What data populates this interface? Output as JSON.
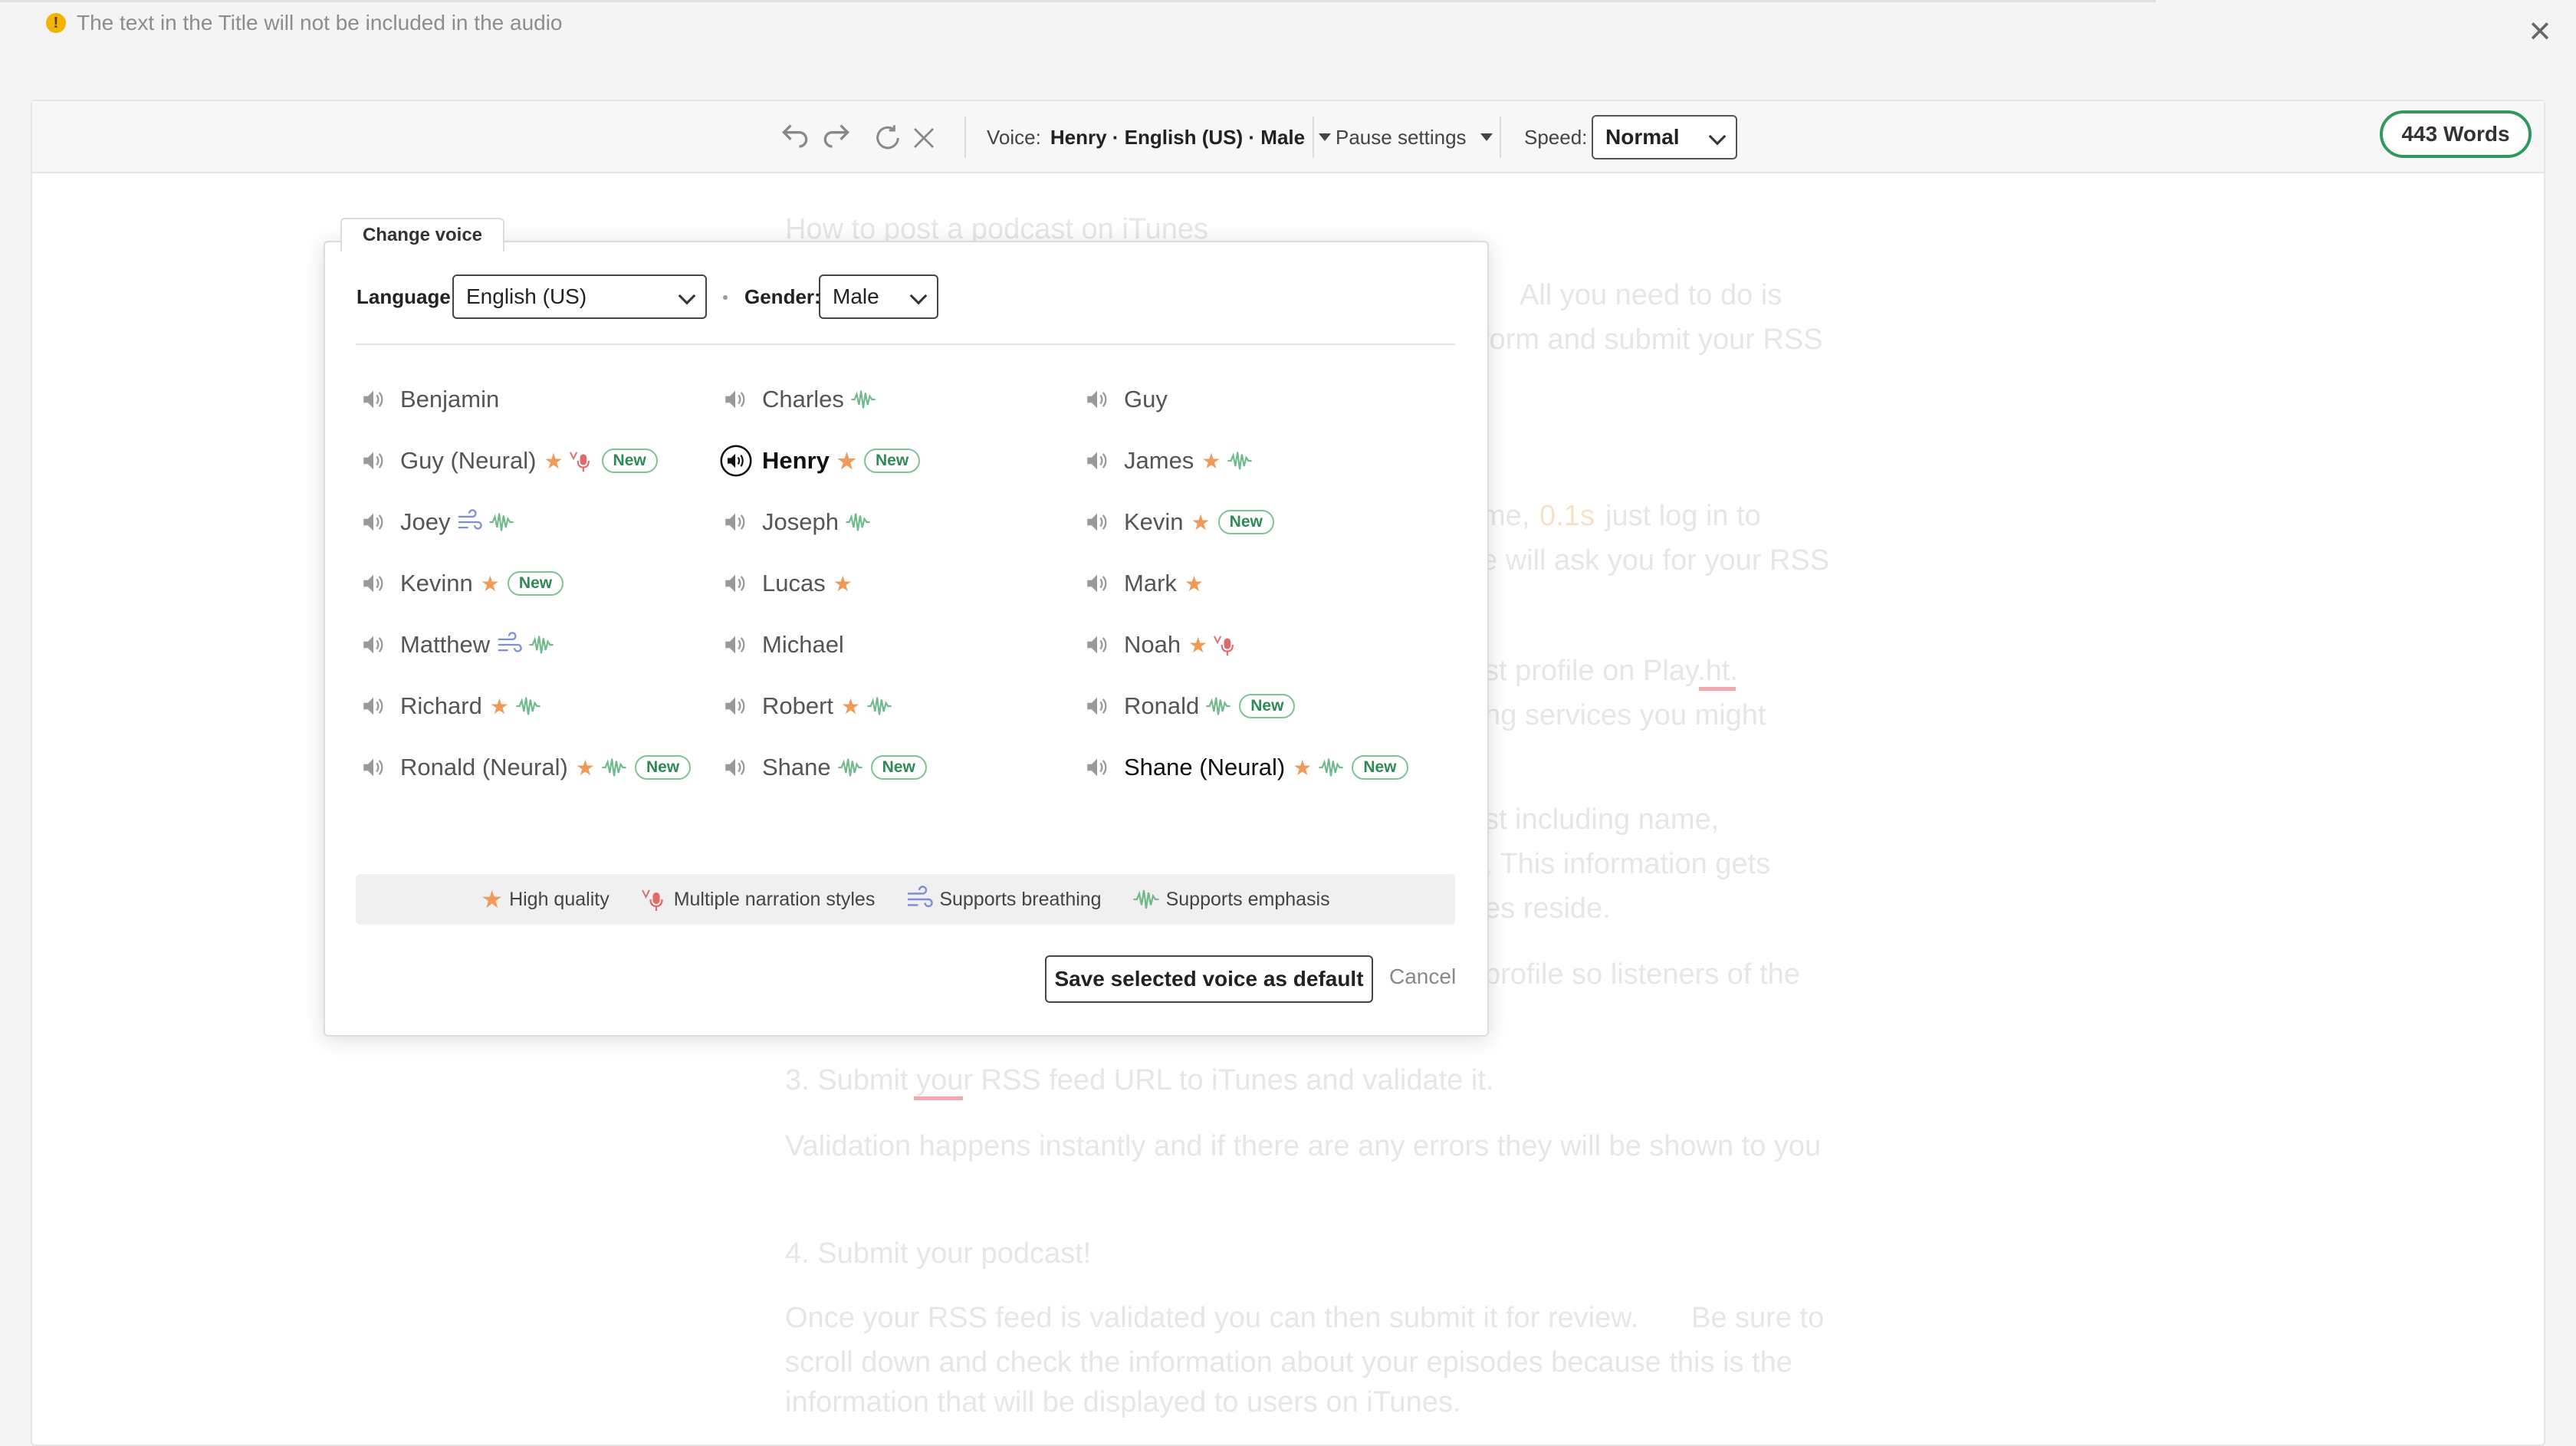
{
  "notice": {
    "text": "The text in the Title will not be included in the audio"
  },
  "toolbar": {
    "voice_label": "Voice:",
    "voice_value": "Henry · English (US) · Male",
    "pause_label": "Pause settings",
    "speed_label": "Speed:",
    "speed_value": "Normal",
    "word_count": "443 Words"
  },
  "background_text": [
    "How to post a podcast on iTunes",
    "All you need to do is",
    "form and submit your RSS",
    "me,",
    "0.1s",
    "just log in to",
    "e will ask you for your RSS",
    "st profile on Play.ht.",
    "ng services you might",
    "st including name,",
    ". This information gets",
    "es reside.",
    "profile so listeners of the",
    "3. Submit your RSS feed URL to iTunes and validate it.",
    "Validation happens instantly and if there are any errors they will be shown to you",
    "4. Submit your podcast!",
    "Once your RSS feed is validated you can then submit it for review.",
    "Be sure to",
    "scroll down and check the information about your episodes because this is the",
    "information that will be displayed to users on iTunes."
  ],
  "modal": {
    "tab_label": "Change voice",
    "language_label": "Language:",
    "language_value": "English (US)",
    "gender_label": "Gender:",
    "gender_value": "Male",
    "new_badge": "New",
    "voices": [
      {
        "name": "Benjamin"
      },
      {
        "name": "Charles"
      },
      {
        "name": "Guy"
      },
      {
        "name": "Guy (Neural)"
      },
      {
        "name": "Henry"
      },
      {
        "name": "James"
      },
      {
        "name": "Joey"
      },
      {
        "name": "Joseph"
      },
      {
        "name": "Kevin"
      },
      {
        "name": "Kevinn"
      },
      {
        "name": "Lucas"
      },
      {
        "name": "Mark"
      },
      {
        "name": "Matthew"
      },
      {
        "name": "Michael"
      },
      {
        "name": "Noah"
      },
      {
        "name": "Richard"
      },
      {
        "name": "Robert"
      },
      {
        "name": "Ronald"
      },
      {
        "name": "Ronald (Neural)"
      },
      {
        "name": "Shane"
      },
      {
        "name": "Shane (Neural)"
      }
    ],
    "selected_voice": "Henry",
    "legend": {
      "high_quality": "High quality",
      "narration_styles": "Multiple narration styles",
      "breathing": "Supports breathing",
      "emphasis": "Supports emphasis"
    },
    "save_label": "Save selected voice as default",
    "cancel_label": "Cancel"
  },
  "colors": {
    "accent_green": "#2e9a5e",
    "star": "#f09a5a",
    "emphasis": "#6fb98a",
    "breathing": "#7a8fd6",
    "mic": "#e06a6a"
  }
}
